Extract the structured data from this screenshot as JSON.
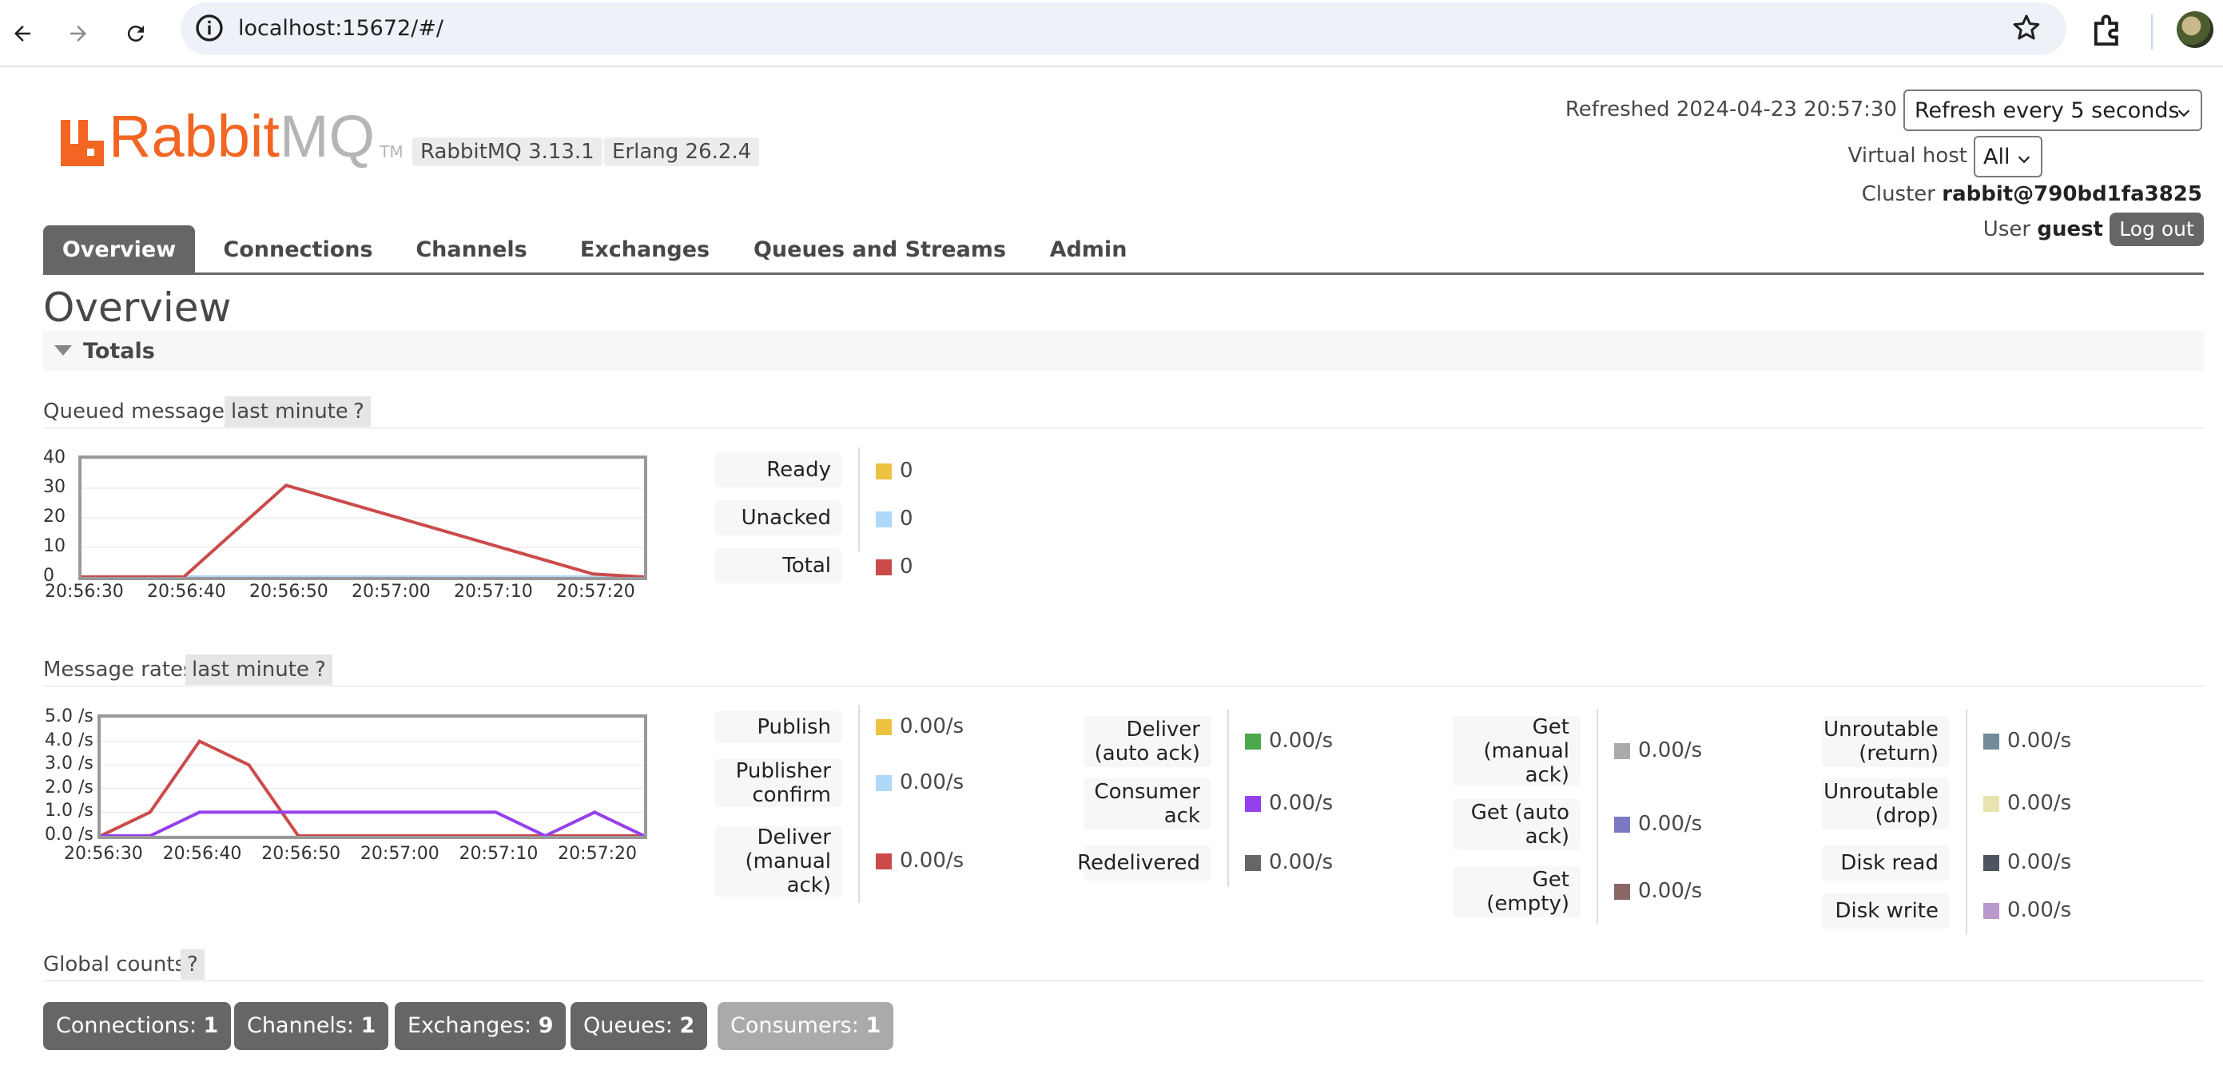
{
  "browser": {
    "url": "localhost:15672/#/",
    "icons": [
      "back-arrow-icon",
      "forward-arrow-icon",
      "reload-icon",
      "site-info-icon",
      "bookmark-star-icon",
      "extensions-icon",
      "profile-avatar"
    ]
  },
  "header": {
    "logo_rabbit": "Rabbit",
    "logo_mq": "MQ",
    "logo_tm": "TM",
    "rabbitmq_version": "RabbitMQ 3.13.1",
    "erlang_version": "Erlang 26.2.4",
    "refreshed": "Refreshed 2024-04-23 20:57:30",
    "refresh_select": "Refresh every 5 seconds",
    "virtual_host_label": "Virtual host",
    "virtual_host_value": "All",
    "cluster_label": "Cluster",
    "cluster_value": "rabbit@790bd1fa3825",
    "user_label": "User",
    "user_value": "guest",
    "logout": "Log out"
  },
  "tabs": [
    "Overview",
    "Connections",
    "Channels",
    "Exchanges",
    "Queues and Streams",
    "Admin"
  ],
  "active_tab": "Overview",
  "page_title": "Overview",
  "totals_label": "Totals",
  "queued": {
    "title": "Queued messages",
    "range": "last minute",
    "help": "?",
    "legend": [
      {
        "label": "Ready",
        "value": "0",
        "color": "#edc240"
      },
      {
        "label": "Unacked",
        "value": "0",
        "color": "#afd8f8"
      },
      {
        "label": "Total",
        "value": "0",
        "color": "#cb4b4b"
      }
    ]
  },
  "rates": {
    "title": "Message rates",
    "range": "last minute",
    "help": "?",
    "columns": [
      [
        {
          "label": "Publish",
          "value": "0.00/s",
          "color": "#edc240"
        },
        {
          "label": "Publisher confirm",
          "value": "0.00/s",
          "color": "#afd8f8"
        },
        {
          "label": "Deliver (manual ack)",
          "value": "0.00/s",
          "color": "#cb4b4b"
        }
      ],
      [
        {
          "label": "Deliver (auto ack)",
          "value": "0.00/s",
          "color": "#4da74d"
        },
        {
          "label": "Consumer ack",
          "value": "0.00/s",
          "color": "#9440ed"
        },
        {
          "label": "Redelivered",
          "value": "0.00/s",
          "color": "#666666"
        }
      ],
      [
        {
          "label": "Get (manual ack)",
          "value": "0.00/s",
          "color": "#aaaaaa"
        },
        {
          "label": "Get (auto ack)",
          "value": "0.00/s",
          "color": "#7c79c3"
        },
        {
          "label": "Get (empty)",
          "value": "0.00/s",
          "color": "#8d6666"
        }
      ],
      [
        {
          "label": "Unroutable (return)",
          "value": "0.00/s",
          "color": "#738c99"
        },
        {
          "label": "Unroutable (drop)",
          "value": "0.00/s",
          "color": "#e8e4b2"
        },
        {
          "label": "Disk read",
          "value": "0.00/s",
          "color": "#4f5560"
        },
        {
          "label": "Disk write",
          "value": "0.00/s",
          "color": "#bb99cc"
        }
      ]
    ]
  },
  "global": {
    "title": "Global counts",
    "help": "?",
    "counts": [
      {
        "label": "Connections:",
        "value": "1"
      },
      {
        "label": "Channels:",
        "value": "1"
      },
      {
        "label": "Exchanges:",
        "value": "9"
      },
      {
        "label": "Queues:",
        "value": "2"
      },
      {
        "label": "Consumers:",
        "value": "1"
      }
    ]
  },
  "chart_data": [
    {
      "type": "line",
      "x_ticks": [
        "20:56:30",
        "20:56:40",
        "20:56:50",
        "20:57:00",
        "20:57:10",
        "20:57:20"
      ],
      "y_ticks": [
        "40",
        "30",
        "20",
        "10",
        "0"
      ],
      "ylim": [
        0,
        40
      ],
      "x_seconds": [
        0,
        10,
        20,
        30,
        40,
        50,
        55
      ],
      "series": [
        {
          "name": "Ready",
          "color": "#edc240",
          "values": [
            0,
            0,
            0,
            0,
            0,
            0,
            0
          ]
        },
        {
          "name": "Unacked",
          "color": "#afd8f8",
          "values": [
            0,
            0,
            0,
            0,
            0,
            0,
            0
          ]
        },
        {
          "name": "Total",
          "color": "#cb4b4b",
          "values": [
            0,
            0,
            31,
            21,
            11,
            1,
            0
          ]
        }
      ]
    },
    {
      "type": "line",
      "x_ticks": [
        "20:56:30",
        "20:56:40",
        "20:56:50",
        "20:57:00",
        "20:57:10",
        "20:57:20"
      ],
      "y_ticks": [
        "5.0 /s",
        "4.0 /s",
        "3.0 /s",
        "2.0 /s",
        "1.0 /s",
        "0.0 /s"
      ],
      "ylim": [
        0,
        5
      ],
      "x_seconds": [
        0,
        5,
        10,
        15,
        20,
        25,
        30,
        35,
        40,
        45,
        50,
        55
      ],
      "series": [
        {
          "name": "Deliver (manual ack)",
          "color": "#cb4b4b",
          "values": [
            0,
            1,
            4,
            3,
            0,
            0,
            0,
            0,
            0,
            0,
            0,
            0
          ]
        },
        {
          "name": "Consumer ack",
          "color": "#9440ed",
          "values": [
            0,
            0,
            1,
            1,
            1,
            1,
            1,
            1,
            1,
            0,
            1,
            0
          ]
        }
      ]
    }
  ]
}
